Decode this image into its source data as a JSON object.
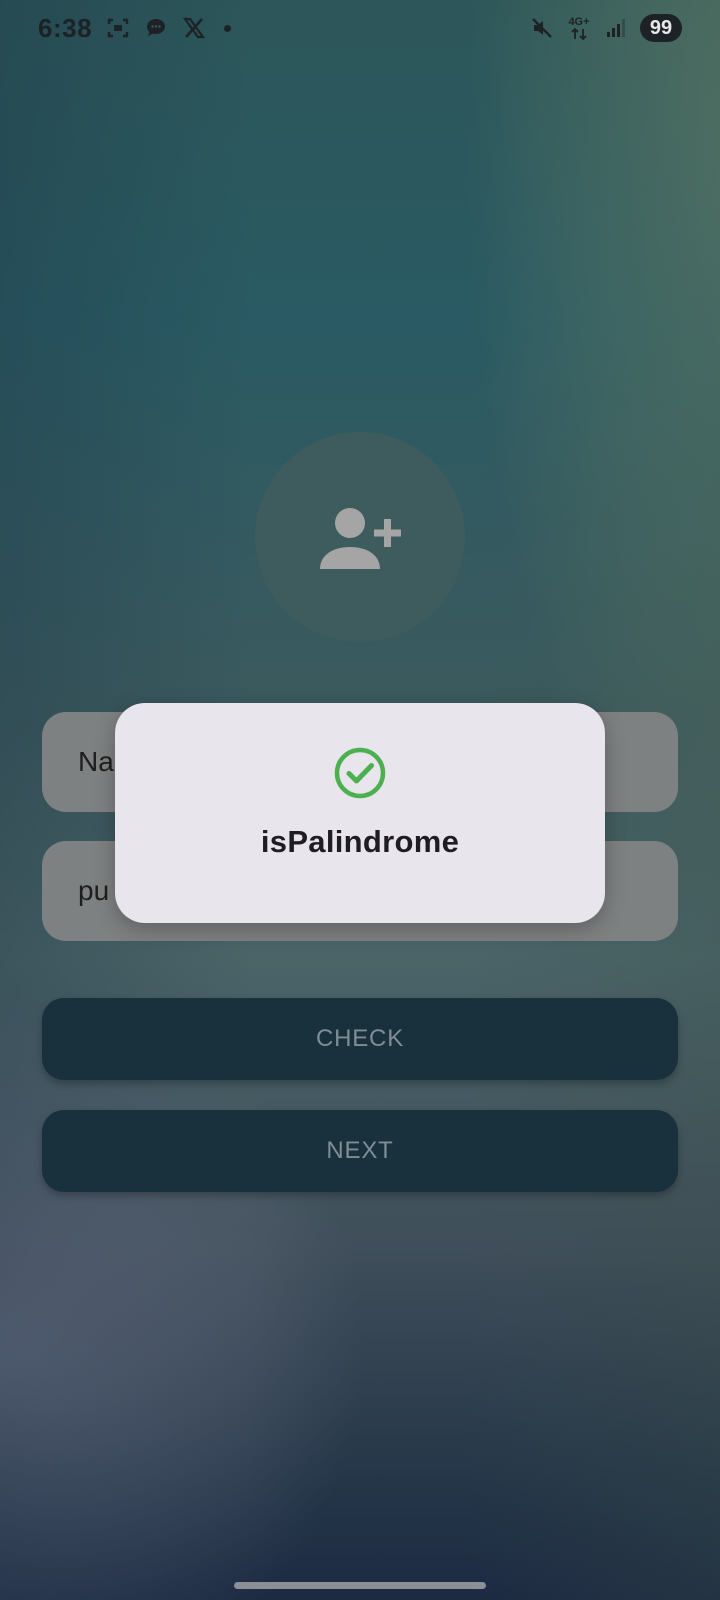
{
  "status_bar": {
    "time": "6:38",
    "network": "4G+",
    "battery": "99"
  },
  "form": {
    "name_field_value": "Na",
    "palindrome_field_value": "pu",
    "check_button_label": "CHECK",
    "next_button_label": "NEXT"
  },
  "dialog": {
    "message": "isPalindrome",
    "icon": "check-circle-icon",
    "icon_color": "#4caf50"
  },
  "colors": {
    "button_bg": "#19303d",
    "dialog_bg": "#e8e5ed"
  }
}
